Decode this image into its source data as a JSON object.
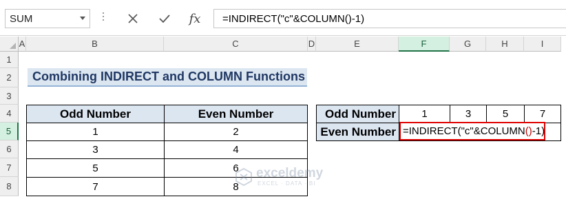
{
  "formula_bar": {
    "name_box": "SUM",
    "cancel_icon": "close-icon",
    "enter_icon": "check-icon",
    "function_label": "fx",
    "formula": "=INDIRECT(\"c\"&COLUMN()-1)"
  },
  "columns": [
    "A",
    "B",
    "C",
    "D",
    "E",
    "F",
    "G",
    "H",
    "I"
  ],
  "rows": [
    "1",
    "2",
    "3",
    "4",
    "5",
    "6",
    "7",
    "8"
  ],
  "active_column": "F",
  "active_row": "5",
  "title": "Combining INDIRECT and COLUMN Functions",
  "left_table": {
    "headers": [
      "Odd Number",
      "Even Number"
    ],
    "rows": [
      [
        "1",
        "2"
      ],
      [
        "3",
        "4"
      ],
      [
        "5",
        "6"
      ],
      [
        "7",
        "8"
      ]
    ]
  },
  "right_table": {
    "row1_label": "Odd Number",
    "row1_values": [
      "1",
      "3",
      "5",
      "7"
    ],
    "row2_label": "Even Number",
    "edit_formula": {
      "part1": "=INDIRECT(\"c\"&COLUMN",
      "paren_open": "(",
      "paren_close": ")",
      "part2": "-1)"
    }
  },
  "watermark": {
    "name": "exceldemy",
    "tagline": "EXCEL · DATA · BI"
  },
  "colors": {
    "header_fill": "#dce6f1",
    "title_text": "#203864",
    "edit_border": "#e00000",
    "selection_green": "#217346"
  }
}
